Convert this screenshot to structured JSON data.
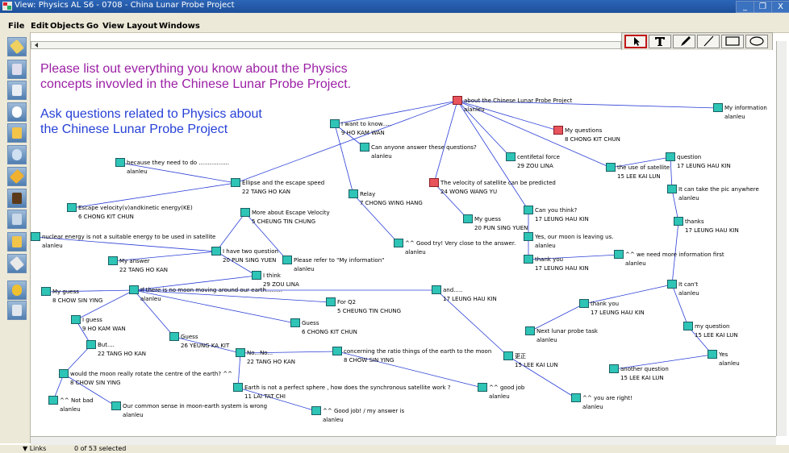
{
  "window": {
    "title": "View: Physics AL S6 - 0708 - China Lunar Probe Project",
    "controls": [
      "_",
      "❐",
      "X"
    ]
  },
  "menu": [
    {
      "label": "File"
    },
    {
      "label": "Edit"
    },
    {
      "label": "Objects"
    },
    {
      "label": "Go"
    },
    {
      "label": "View"
    },
    {
      "label": "Layout"
    },
    {
      "label": "Windows"
    }
  ],
  "draw_tools": [
    {
      "icon": "arrow-pointer-icon",
      "glyph": "➤",
      "selected": true
    },
    {
      "icon": "text-tool-icon",
      "glyph": "T"
    },
    {
      "icon": "pen-icon",
      "glyph": "✎"
    },
    {
      "icon": "line-icon",
      "glyph": "╱"
    },
    {
      "icon": "rectangle-icon",
      "glyph": "▭"
    },
    {
      "icon": "ellipse-icon",
      "glyph": "◯"
    }
  ],
  "sidebar_tools": [
    "pencil-icon",
    "scissors-icon",
    "eraser-icon",
    "zoom-icon",
    "note-icon",
    "search-icon",
    "link-icon",
    "people-icon",
    "chart-icon",
    "bar-chart-icon",
    "brush-icon",
    "help-icon",
    "door-icon"
  ],
  "prompts": {
    "main_line1": "Please list out everything you know about the Physics",
    "main_line2": "concepts invovled in the Chinese Lunar Probe Project.",
    "ask_line1": "Ask questions related to Physics about",
    "ask_line2": "the Chinese Lunar Probe Project"
  },
  "status": {
    "filter": "▼ Links",
    "selection": "0 of 53 selected"
  },
  "nodes": [
    {
      "text": "about the Chinese Lunar Probe Project",
      "author": "alanleu",
      "red": true
    },
    {
      "text": "My information",
      "author": "alanleu"
    },
    {
      "text": "My questions",
      "author": "8 CHONG KIT CHUN",
      "red": true
    },
    {
      "text": "I want to know.....",
      "author": "9 HO KAM WAN"
    },
    {
      "text": "Can anyone answer these questions?",
      "author": "alanleu"
    },
    {
      "text": "centifetal force",
      "author": "29 ZOU LINA"
    },
    {
      "text": "the use of satellite",
      "author": "15 LEE KAI LUN"
    },
    {
      "text": "question",
      "author": "17 LEUNG HAU KIN"
    },
    {
      "text": "because they need to do .................",
      "author": "alanleu"
    },
    {
      "text": "Ellipse and the escape speed",
      "author": "22 TANG HO KAN"
    },
    {
      "text": "Relay",
      "author": "7 CHONG WING HANG"
    },
    {
      "text": "The velocity of satellite can be predicted",
      "author": "24 WONG WANG YU",
      "red": true
    },
    {
      "text": "It can take the pic anywhere",
      "author": "alanleu"
    },
    {
      "text": "Escape velocity(v)andkinetic energy(KE)",
      "author": "6 CHONG KIT CHUN"
    },
    {
      "text": "More about Escape Velocity",
      "author": "5 CHEUNG TIN CHUNG"
    },
    {
      "text": "Can you think?",
      "author": "17 LEUNG HAU KIN"
    },
    {
      "text": "My guess",
      "author": "20 PUN SING YUEN"
    },
    {
      "text": "thanks",
      "author": "17 LEUNG HAU KIN"
    },
    {
      "text": "nuclear energy is not a suitable energy to be used in satellite",
      "author": "alanleu"
    },
    {
      "text": "Yes, our moon is leaving us.",
      "author": "alanleu"
    },
    {
      "text": "^^ Good try! Very close to the answer.",
      "author": "alanleu"
    },
    {
      "text": "I have two question",
      "author": "20 PUN SING YUEN"
    },
    {
      "text": "My answer",
      "author": "22 TANG HO KAN"
    },
    {
      "text": "Please refer to \"My information\"",
      "author": "alanleu"
    },
    {
      "text": "^^ we need more information first",
      "author": "alanleu"
    },
    {
      "text": "thank you",
      "author": "17 LEUNG HAU KIN"
    },
    {
      "text": "I think",
      "author": "29 ZOU LINA"
    },
    {
      "text": "It can't",
      "author": "alanleu"
    },
    {
      "text": "My guess",
      "author": "8 CHOW SIN YING"
    },
    {
      "text": "If there is no moon moving around our earth.........",
      "author": "alanleu"
    },
    {
      "text": "and.....",
      "author": "17 LEUNG HAU KIN"
    },
    {
      "text": "For Q2",
      "author": "5 CHEUNG TIN CHUNG"
    },
    {
      "text": "thank you",
      "author": "17 LEUNG HAU KIN"
    },
    {
      "text": "Guess",
      "author": "6 CHONG KIT CHUN"
    },
    {
      "text": "I guess",
      "author": "9 HO KAM WAN"
    },
    {
      "text": "my question",
      "author": "15 LEE KAI LUN"
    },
    {
      "text": "Next lunar probe task",
      "author": "alanleu"
    },
    {
      "text": "Guess",
      "author": "26 YEUNG KA KIT"
    },
    {
      "text": "But....",
      "author": "22 TANG HO KAN"
    },
    {
      "text": "No...No...",
      "author": "22 TANG HO KAN"
    },
    {
      "text": "concerning the ratio things of the earth to the moon",
      "author": "8 CHOW SIN YING"
    },
    {
      "text": "更正",
      "author": "15 LEE KAI LUN"
    },
    {
      "text": "Yes",
      "author": "alanleu"
    },
    {
      "text": "another question",
      "author": "15 LEE KAI LUN"
    },
    {
      "text": "would the moon really rotate the centre of the earth? ^^",
      "author": "8 CHOW SIN YING"
    },
    {
      "text": "Earth is not a perfect sphere , how does the synchronous satellite work ?",
      "author": "11 LAI TAT CHI"
    },
    {
      "text": "^^ good job",
      "author": "alanleu"
    },
    {
      "text": "^^ Not bad",
      "author": "alanleu"
    },
    {
      "text": "Our common sense in moon-earth system is wrong",
      "author": "alanleu"
    },
    {
      "text": "^^ you are right!",
      "author": "alanleu"
    },
    {
      "text": "^^ Good job! / my answer is",
      "author": "alanleu"
    }
  ],
  "links": [
    [
      0,
      1
    ],
    [
      0,
      2
    ],
    [
      0,
      3
    ],
    [
      0,
      5
    ],
    [
      0,
      6
    ],
    [
      0,
      9
    ],
    [
      0,
      11
    ],
    [
      0,
      15
    ],
    [
      3,
      4
    ],
    [
      3,
      10
    ],
    [
      10,
      20
    ],
    [
      11,
      16
    ],
    [
      15,
      19
    ],
    [
      19,
      25
    ],
    [
      25,
      24
    ],
    [
      6,
      7
    ],
    [
      7,
      12
    ],
    [
      12,
      17
    ],
    [
      17,
      27
    ],
    [
      27,
      32
    ],
    [
      32,
      36
    ],
    [
      27,
      35
    ],
    [
      35,
      42
    ],
    [
      42,
      43
    ],
    [
      9,
      8
    ],
    [
      9,
      13
    ],
    [
      14,
      21
    ],
    [
      21,
      18
    ],
    [
      21,
      22
    ],
    [
      14,
      23
    ],
    [
      21,
      26
    ],
    [
      26,
      29
    ],
    [
      28,
      29
    ],
    [
      29,
      30
    ],
    [
      29,
      31
    ],
    [
      29,
      33
    ],
    [
      29,
      34
    ],
    [
      34,
      38
    ],
    [
      38,
      44
    ],
    [
      44,
      47
    ],
    [
      44,
      48
    ],
    [
      29,
      37
    ],
    [
      37,
      39
    ],
    [
      39,
      40
    ],
    [
      40,
      46
    ],
    [
      39,
      45
    ],
    [
      45,
      50
    ],
    [
      30,
      41
    ],
    [
      41,
      49
    ]
  ]
}
